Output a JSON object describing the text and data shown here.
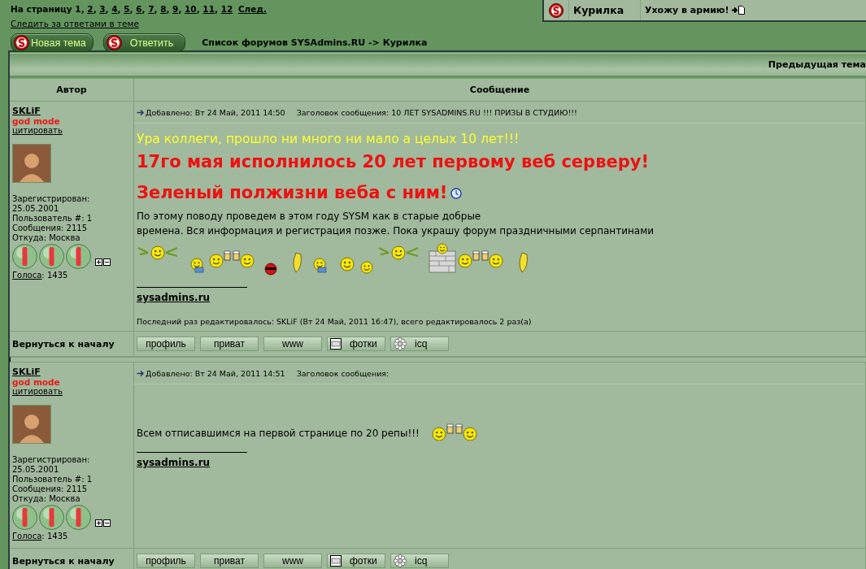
{
  "pagination": {
    "label": "На страницу",
    "pages": [
      {
        "label": "1",
        "selected": true
      },
      {
        "label": "2",
        "selected": false
      },
      {
        "label": "3",
        "selected": false
      },
      {
        "label": "4",
        "selected": false
      },
      {
        "label": "5",
        "selected": false
      },
      {
        "label": "6",
        "selected": false
      },
      {
        "label": "7",
        "selected": false
      },
      {
        "label": "8",
        "selected": false
      },
      {
        "label": "9",
        "selected": false
      },
      {
        "label": "10",
        "selected": false
      },
      {
        "label": "11",
        "selected": false
      },
      {
        "label": "12",
        "selected": false
      }
    ],
    "separator": ",",
    "next": "След."
  },
  "watch_link": "Следить за ответами в теме",
  "forum_box": {
    "forum": "Курилка",
    "topic": "Ухожу в армию!"
  },
  "buttons": [
    {
      "label": "Новая тема"
    },
    {
      "label": "Ответить"
    }
  ],
  "breadcrumb": "Список форумов SYSAdmins.RU -> Курилка",
  "nav": {
    "previous_topic": "Предыдущая тема"
  },
  "columns": [
    "Автор",
    "Сообщение"
  ],
  "posts": [
    {
      "author": "SKLiF",
      "rank": "god mode",
      "quote": "цитировать",
      "info": [
        "Зарегистрирован:",
        "25.05.2001",
        "Пользователь #: 1",
        "Сообщения: 2115",
        "Откуда: Москва"
      ],
      "votes_label": "Голоса",
      "votes": ": 1435",
      "added": "Добавлено: Вт 24 Май, 2011 14:50",
      "subject": "Заголовок сообщения: 10 ЛЕТ SYSADMINS.RU !!! ПРИЗЫ В СТУДИЮ!!!",
      "body": [
        {
          "kind": "greeting",
          "text": "Ура коллеги, прошло ни много ни мало а целых 10 лет!!!"
        },
        {
          "kind": "headline",
          "text": "17го мая исполнилось 20 лет первому веб серверу!"
        },
        {
          "kind": "headline",
          "text": "Зеленый полжизни веба с ним!",
          "emoticon": true
        },
        {
          "kind": "paragraph",
          "lines": [
            "По этому поводу проведем в этом году SYSM как в старые добрые",
            "времена. Вся информация и регистрация позже. Пока украшу форум праздничными серпантинами"
          ]
        },
        {
          "kind": "emoticons"
        }
      ],
      "signature": "sysadmins.ru",
      "edited": "Последний раз редактировалось: SKLiF (Вт 24 Май, 2011 16:47), всего редактировалось 2 раз(а)",
      "back": "Вернуться к началу",
      "links": [
        {
          "label": "профиль",
          "kind": "plain"
        },
        {
          "label": "приват",
          "kind": "plain"
        },
        {
          "label": "www",
          "kind": "plain"
        },
        {
          "label": "фотки",
          "kind": "photos"
        },
        {
          "label": "icq",
          "kind": "icq"
        }
      ]
    },
    {
      "author": "SKLiF",
      "rank": "god mode",
      "quote": "цитировать",
      "info": [
        "Зарегистрирован:",
        "25.05.2001",
        "Пользователь #: 1",
        "Сообщения: 2115",
        "Откуда: Москва"
      ],
      "votes_label": "Голоса",
      "votes": ": 1435",
      "added": "Добавлено: Вт 24 Май, 2011 14:51",
      "subject": "Заголовок сообщения:",
      "body": [
        {
          "kind": "paragraph",
          "lines": [
            "Всем отписавшимся на первой странице по 20 репы!!!"
          ],
          "emoticon": true
        }
      ],
      "signature": "sysadmins.ru",
      "back": "Вернуться к началу",
      "links": [
        {
          "label": "профиль",
          "kind": "plain"
        },
        {
          "label": "приват",
          "kind": "plain"
        },
        {
          "label": "www",
          "kind": "plain"
        },
        {
          "label": "фотки",
          "kind": "photos"
        },
        {
          "label": "icq",
          "kind": "icq"
        }
      ]
    }
  ]
}
